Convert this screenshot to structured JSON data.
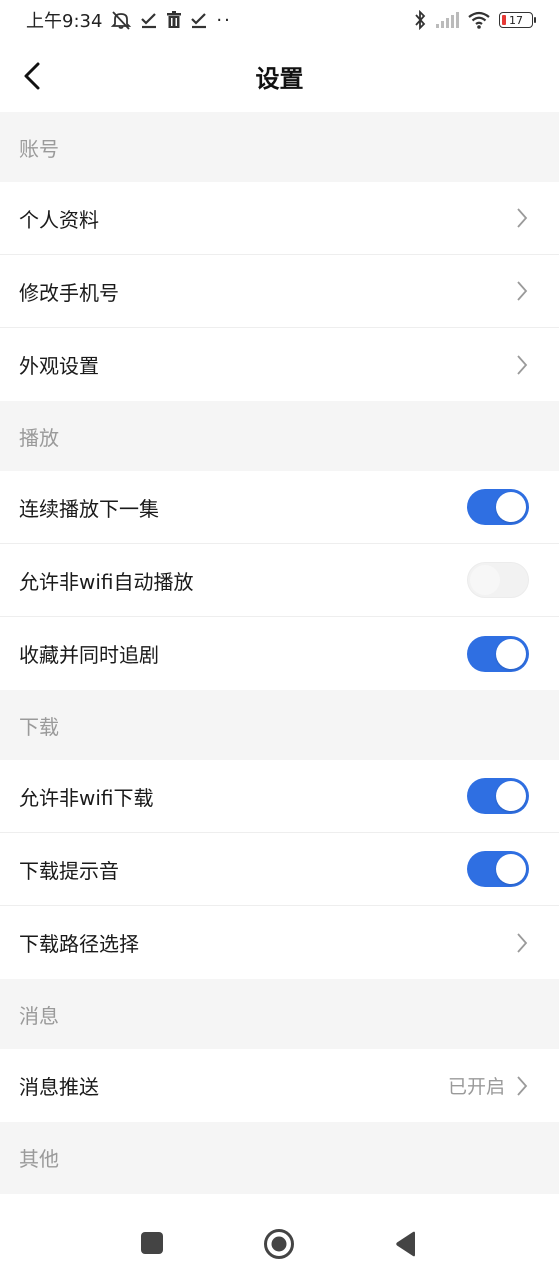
{
  "status_bar": {
    "time": "上午9:34",
    "battery_level": "17",
    "icons": [
      "bell-off-icon",
      "check-icon",
      "trash-icon",
      "check-icon",
      "more-dots-icon",
      "bluetooth-icon",
      "signal-icon",
      "wifi-icon",
      "battery-icon"
    ],
    "more": "··"
  },
  "nav": {
    "title": "设置",
    "back_icon": "chevron-left-icon"
  },
  "sections": [
    {
      "title": "账号",
      "rows": [
        {
          "label": "个人资料",
          "type": "link"
        },
        {
          "label": "修改手机号",
          "type": "link"
        },
        {
          "label": "外观设置",
          "type": "link"
        }
      ]
    },
    {
      "title": "播放",
      "rows": [
        {
          "label": "连续播放下一集",
          "type": "toggle",
          "on": true
        },
        {
          "label": "允许非wifi自动播放",
          "type": "toggle",
          "on": false
        },
        {
          "label": "收藏并同时追剧",
          "type": "toggle",
          "on": true
        }
      ]
    },
    {
      "title": "下载",
      "rows": [
        {
          "label": "允许非wifi下载",
          "type": "toggle",
          "on": true
        },
        {
          "label": "下载提示音",
          "type": "toggle",
          "on": true
        },
        {
          "label": "下载路径选择",
          "type": "link"
        }
      ]
    },
    {
      "title": "消息",
      "rows": [
        {
          "label": "消息推送",
          "type": "link",
          "value": "已开启"
        }
      ]
    },
    {
      "title": "其他",
      "rows": []
    }
  ],
  "colors": {
    "accent": "#2f6fe2",
    "section_text": "#9a9a9a",
    "background": "#f5f5f5"
  },
  "system_nav": [
    "recent-apps-icon",
    "home-icon",
    "back-triangle-icon"
  ]
}
